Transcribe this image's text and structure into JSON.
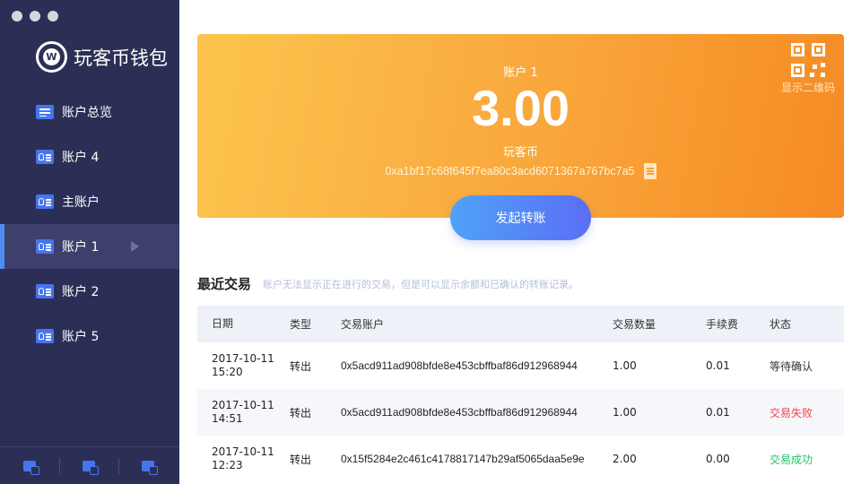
{
  "app": {
    "logo_text": "玩客币钱包",
    "logo_glyph": "W"
  },
  "sidebar": {
    "items": [
      {
        "label": "账户总览",
        "icon": "list-icon"
      },
      {
        "label": "账户 4",
        "icon": "id-card-icon"
      },
      {
        "label": "主账户",
        "icon": "id-card-icon"
      },
      {
        "label": "账户 1",
        "icon": "id-card-icon",
        "active": true
      },
      {
        "label": "账户 2",
        "icon": "id-card-icon"
      },
      {
        "label": "账户 5",
        "icon": "id-card-icon"
      }
    ],
    "footer_icons": [
      "add-account-icon",
      "import-account-icon",
      "settings-account-icon"
    ]
  },
  "card": {
    "account_name": "账户 1",
    "balance": "3.00",
    "coin": "玩客币",
    "address": "0xa1bf17c68f645f7ea80c3acd6071367a767bc7a5",
    "qr_label": "显示二维码",
    "send_label": "发起转账",
    "gradient": [
      "#fcc54e",
      "#f68a24"
    ]
  },
  "transactions": {
    "title": "最近交易",
    "hint": "账户无法显示正在进行的交易，但是可以显示余额和已确认的转账记录。",
    "headers": [
      "日期",
      "类型",
      "交易账户",
      "交易数量",
      "手续费",
      "状态"
    ],
    "rows": [
      {
        "date": "2017-10-11",
        "time": "15:20",
        "type": "转出",
        "account": "0x5acd911ad908bfde8e453cbffbaf86d912968944",
        "amount": "1.00",
        "fee": "0.01",
        "status": "等待确认",
        "status_kind": "wait"
      },
      {
        "date": "2017-10-11",
        "time": "14:51",
        "type": "转出",
        "account": "0x5acd911ad908bfde8e453cbffbaf86d912968944",
        "amount": "1.00",
        "fee": "0.01",
        "status": "交易失败",
        "status_kind": "fail"
      },
      {
        "date": "2017-10-11",
        "time": "12:23",
        "type": "转出",
        "account": "0x15f5284e2c461c4178817147b29af5065daa5e9e",
        "amount": "2.00",
        "fee": "0.00",
        "status": "交易成功",
        "status_kind": "ok"
      }
    ]
  },
  "colors": {
    "sidebar_bg": "#2c2f55",
    "accent": "#4675ee",
    "status_fail": "#f0474f",
    "status_ok": "#27c26a"
  }
}
